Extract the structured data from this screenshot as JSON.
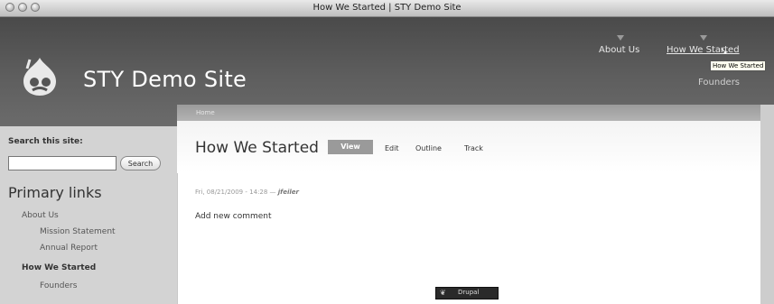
{
  "window": {
    "title": "How We Started | STY Demo Site"
  },
  "site": {
    "name": "STY Demo Site"
  },
  "primary_nav": {
    "items": [
      "About Us",
      "How We Started"
    ],
    "tooltip": "How We Started",
    "sub_item": "Founders"
  },
  "breadcrumb": "Home",
  "sidebar": {
    "search_label": "Search this site:",
    "search_placeholder": "",
    "search_button": "Search",
    "block_title": "Primary links",
    "menu": {
      "about": "About Us",
      "mission": "Mission Statement",
      "annual": "Annual Report",
      "how_we_started": "How We Started",
      "founders": "Founders"
    }
  },
  "node": {
    "title": "How We Started",
    "tabs": [
      "View",
      "Edit",
      "Outline",
      "Track"
    ],
    "submitted_date": "Fri, 08/21/2009 - 14:28 — ",
    "author": "jfeiler",
    "add_comment": "Add new comment"
  },
  "footer": {
    "badge": "Drupal"
  },
  "colors": {
    "header": "#5a5a5a",
    "sidebar": "#d3d3d3",
    "active_tab": "#9a9a9a"
  }
}
